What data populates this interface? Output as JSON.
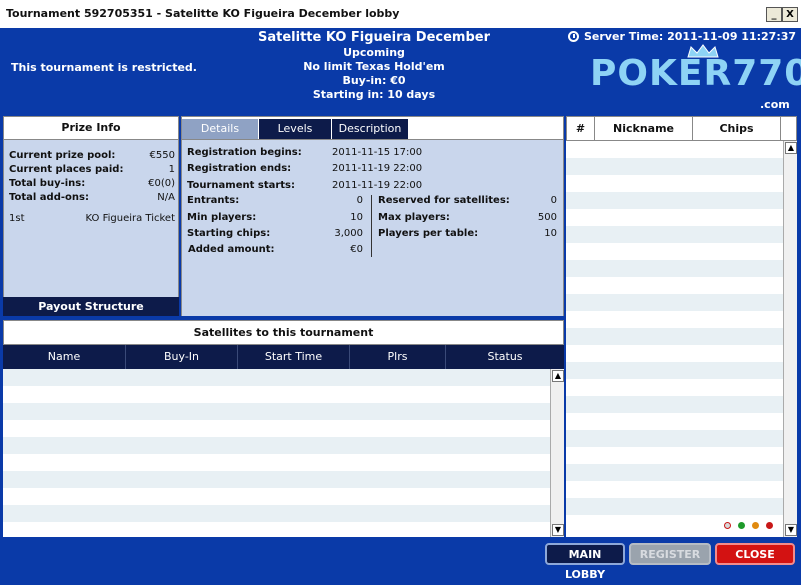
{
  "window": {
    "title": "Tournament 592705351 - Satelitte KO Figueira December lobby",
    "minimize_label": "_",
    "close_label": "X"
  },
  "header": {
    "restricted": "This tournament is restricted.",
    "tournament_name": "Satelitte KO Figueira December",
    "status": "Upcoming",
    "game": "No limit Texas Hold'em",
    "buyin": "Buy-in: €0",
    "starting_in": "Starting in: 10 days",
    "server_time": "Server Time: 2011-11-09 11:27:37",
    "logo_text": "POKER770",
    "logo_suffix": ".com"
  },
  "prize": {
    "title": "Prize Info",
    "rows": [
      {
        "label": "Current prize pool:",
        "value": "€550"
      },
      {
        "label": "Current places paid:",
        "value": "1"
      },
      {
        "label": "Total buy-ins:",
        "value": "€0(0)"
      },
      {
        "label": "Total add-ons:",
        "value": "N/A"
      }
    ],
    "payouts": [
      {
        "place": "1st",
        "prize": "KO Figueira Ticket"
      }
    ],
    "payout_button": "Payout Structure"
  },
  "tabs": [
    "Details",
    "Levels",
    "Description"
  ],
  "details": {
    "dates": [
      {
        "label": "Registration begins:",
        "value": "2011-11-15 17:00"
      },
      {
        "label": "Registration ends:",
        "value": "2011-11-19 22:00"
      },
      {
        "label": "Tournament starts:",
        "value": "2011-11-19 22:00"
      }
    ],
    "left": [
      {
        "label": "Entrants:",
        "value": "0"
      },
      {
        "label": "Min players:",
        "value": "10"
      },
      {
        "label": "Starting chips:",
        "value": "3,000"
      },
      {
        "label": "Added amount:",
        "value": "€0"
      }
    ],
    "right": [
      {
        "label": "Reserved for satellites:",
        "value": "0"
      },
      {
        "label": "Max players:",
        "value": "500"
      },
      {
        "label": "Players per table:",
        "value": "10"
      }
    ]
  },
  "satellites": {
    "title": "Satellites to this tournament",
    "columns": [
      "Name",
      "Buy-In",
      "Start Time",
      "Plrs",
      "Status"
    ]
  },
  "players": {
    "columns": [
      "#",
      "Nickname",
      "Chips"
    ]
  },
  "status_dots": [
    {
      "name": "gray-dot",
      "color": "#d8d8d8"
    },
    {
      "name": "green-dot",
      "color": "#1e9a2a"
    },
    {
      "name": "orange-dot",
      "color": "#e08a10"
    },
    {
      "name": "red-dot",
      "color": "#c81818"
    }
  ],
  "footer": {
    "main_lobby": "MAIN LOBBY",
    "register": "REGISTER",
    "close": "CLOSE"
  },
  "colors": {
    "background": "#0a3aa8",
    "panel": "#c9d6ec",
    "dark": "#0d1b4a",
    "stripe": "#e8f0f4",
    "close_button": "#d31212"
  }
}
